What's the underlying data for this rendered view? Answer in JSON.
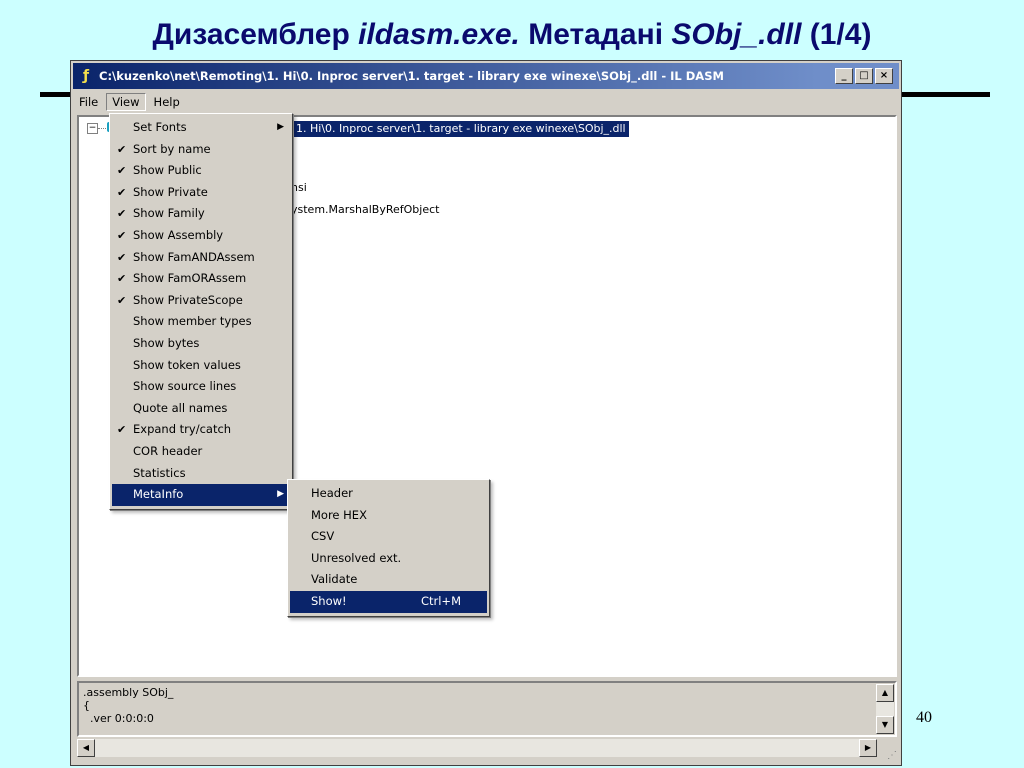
{
  "slide": {
    "title_part1": "Дизасемблер ",
    "title_italic1": "ildasm.exe.",
    "title_part2": " Метадані ",
    "title_italic2": "SObj_.dll",
    "title_part3": "  (1/4)",
    "page_number": "40"
  },
  "window": {
    "title": "C:\\kuzenko\\net\\Remoting\\1. Hi\\0. Inproc server\\1. target -  library exe winexe\\SObj_.dll - IL DASM",
    "buttons": {
      "minimize": "_",
      "maximize": "□",
      "close": "×"
    },
    "menubar": [
      "File",
      "View",
      "Help"
    ]
  },
  "tree": {
    "selected_text": "1. Hi\\0. Inproc server\\1. target -  library exe winexe\\SObj_.dll",
    "line2": "nsi",
    "line3": "ystem.MarshalByRefObject"
  },
  "view_menu": [
    {
      "label": "Set Fonts",
      "checked": false,
      "submenu": true
    },
    {
      "label": "Sort by name",
      "checked": true
    },
    {
      "label": "Show Public",
      "checked": true
    },
    {
      "label": "Show Private",
      "checked": true
    },
    {
      "label": "Show Family",
      "checked": true
    },
    {
      "label": "Show Assembly",
      "checked": true
    },
    {
      "label": "Show FamANDAssem",
      "checked": true
    },
    {
      "label": "Show FamORAssem",
      "checked": true
    },
    {
      "label": "Show PrivateScope",
      "checked": true
    },
    {
      "label": "Show member types",
      "checked": false
    },
    {
      "label": "Show bytes",
      "checked": false
    },
    {
      "label": "Show token values",
      "checked": false
    },
    {
      "label": "Show source lines",
      "checked": false
    },
    {
      "label": "Quote all names",
      "checked": false
    },
    {
      "label": "Expand try/catch",
      "checked": true
    },
    {
      "label": "COR header",
      "checked": false
    },
    {
      "label": "Statistics",
      "checked": false
    },
    {
      "label": "MetaInfo",
      "checked": false,
      "submenu": true,
      "highlighted": true
    }
  ],
  "metainfo_menu": [
    {
      "label": "Header"
    },
    {
      "label": "More HEX"
    },
    {
      "label": "CSV"
    },
    {
      "label": "Unresolved ext."
    },
    {
      "label": "Validate"
    },
    {
      "label": "Show!",
      "accel": "Ctrl+M",
      "highlighted": true
    }
  ],
  "info_pane": {
    "lines": [
      ".assembly SObj_",
      "{",
      "  .ver 0:0:0:0"
    ]
  },
  "icons": {
    "app": "ildasm-icon",
    "check": "✔",
    "submenu_arrow": "▶"
  },
  "colors": {
    "slide_bg": "#ccffff",
    "title": "#0a0a6e",
    "highlight": "#0a246a",
    "window": "#d4d0c8"
  }
}
